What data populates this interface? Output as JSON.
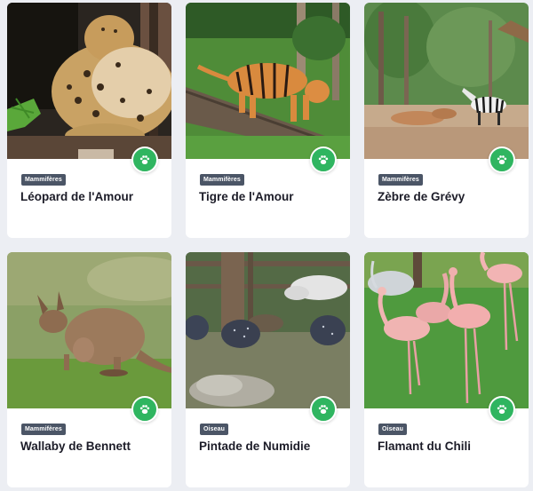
{
  "cards": [
    {
      "category": "Mammifères",
      "name": "Léopard de l'Amour",
      "photo": "amur-leopard-photo"
    },
    {
      "category": "Mammifères",
      "name": "Tigre de l'Amour",
      "photo": "amur-tiger-photo"
    },
    {
      "category": "Mammifères",
      "name": "Zèbre de Grévy",
      "photo": "grevy-zebra-photo"
    },
    {
      "category": "Mammifères",
      "name": "Wallaby de Bennett",
      "photo": "bennett-wallaby-photo"
    },
    {
      "category": "Oiseau",
      "name": "Pintade de Numidie",
      "photo": "helmeted-guineafowl-photo"
    },
    {
      "category": "Oiseau",
      "name": "Flamant du Chili",
      "photo": "chilean-flamingo-photo"
    }
  ],
  "icons": {
    "card_button": "paw-icon"
  },
  "colors": {
    "accent": "#2fb560",
    "badge": "#4b5566",
    "title": "#1c1c28",
    "background": "#eceef3"
  }
}
